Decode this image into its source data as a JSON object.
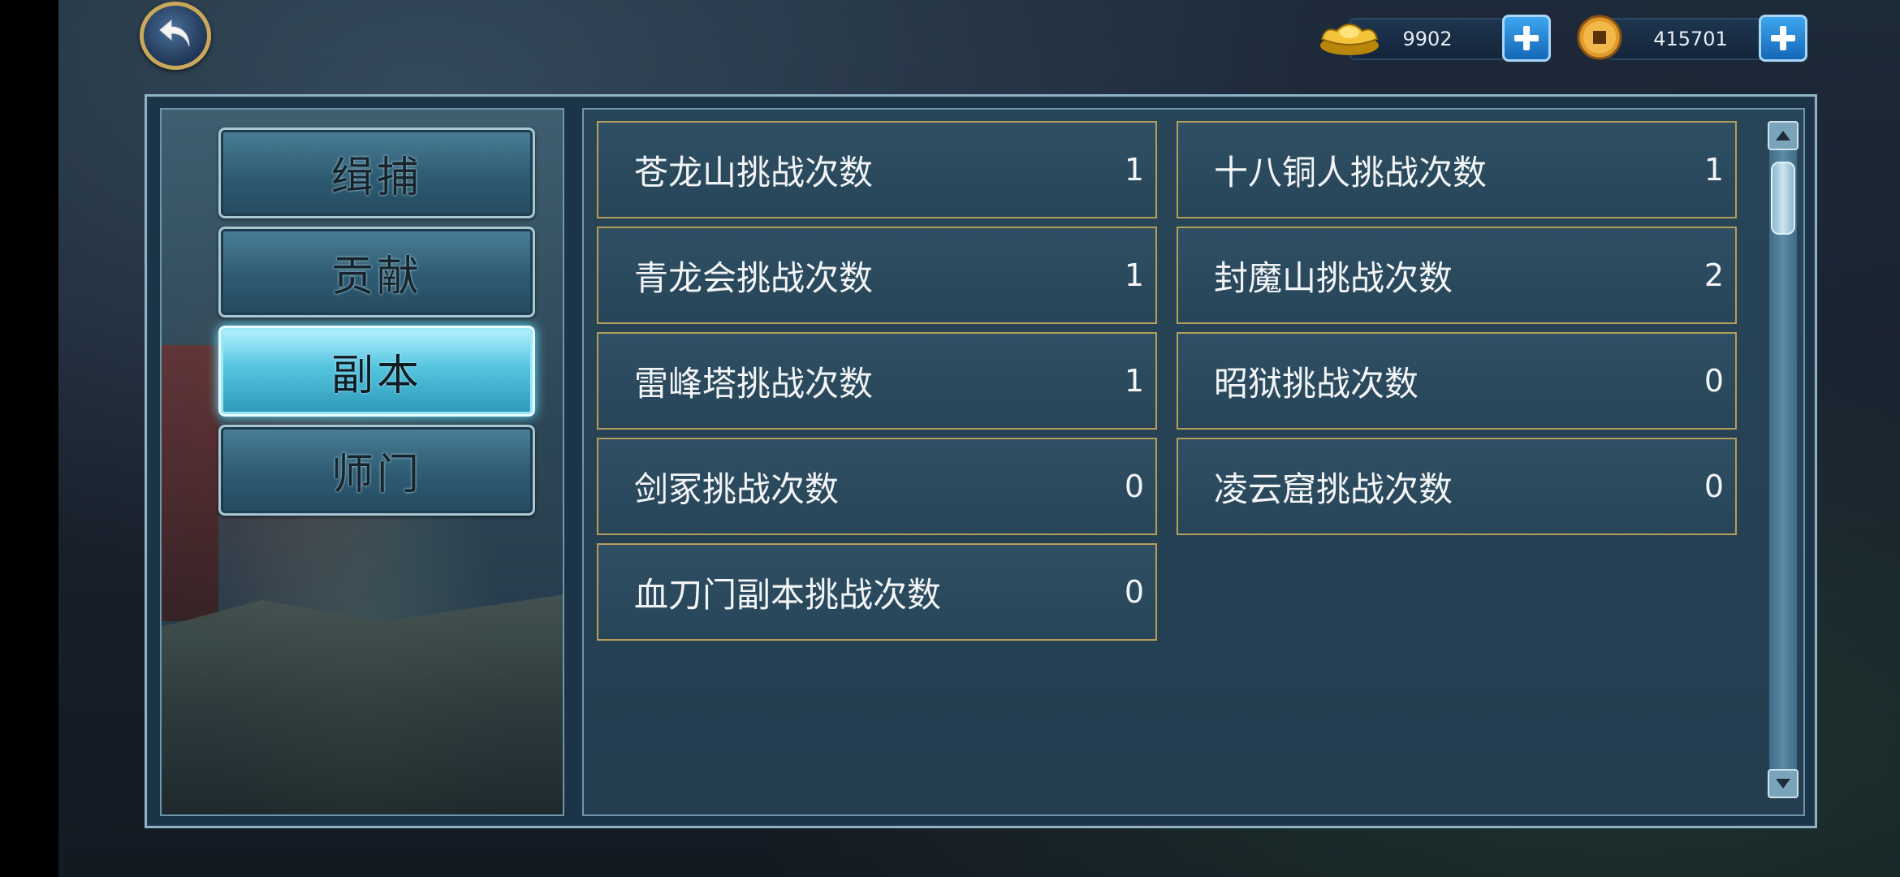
{
  "currencies": [
    {
      "icon": "gold-ingot-icon",
      "value": "9902"
    },
    {
      "icon": "copper-coin-icon",
      "value": "415701"
    }
  ],
  "tabs": [
    {
      "label": "缉捕",
      "active": false
    },
    {
      "label": "贡献",
      "active": false
    },
    {
      "label": "副本",
      "active": true
    },
    {
      "label": "师门",
      "active": false
    }
  ],
  "stats": [
    {
      "label": "苍龙山挑战次数",
      "value": "1"
    },
    {
      "label": "十八铜人挑战次数",
      "value": "1"
    },
    {
      "label": "青龙会挑战次数",
      "value": "1"
    },
    {
      "label": "封魔山挑战次数",
      "value": "2"
    },
    {
      "label": "雷峰塔挑战次数",
      "value": "1"
    },
    {
      "label": "昭狱挑战次数",
      "value": "0"
    },
    {
      "label": "剑冢挑战次数",
      "value": "0"
    },
    {
      "label": "凌云窟挑战次数",
      "value": "0"
    },
    {
      "label": "血刀门副本挑战次数",
      "value": "0"
    }
  ],
  "colors": {
    "panel_bg": "#1c3447",
    "cell_border": "#b59e5a",
    "tab_active": "#55c5e0",
    "plus_button": "#1e86d4"
  }
}
